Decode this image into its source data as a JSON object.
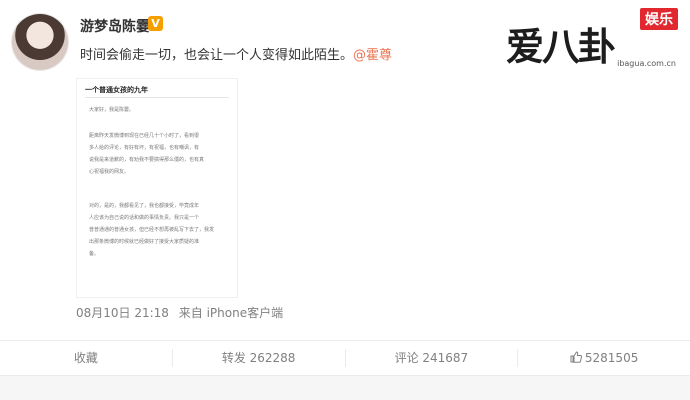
{
  "post": {
    "username": "游梦岛陈霎",
    "text": "时间会偷走一切，也会让一个人变得如此陌生。",
    "mention": "@霍尊",
    "timestamp": "08月10日 21:18",
    "source": "来自 iPhone客户端"
  },
  "article": {
    "title": "一个普通女孩的九年",
    "lines": [
      "大家好，我是陈霎。",
      "距离昨天发微博到现在已经几十个小时了，看到很",
      "多人给的评论，有好有坏，有祝福，也有嘲讽，有",
      "说我是来道歉的，有劝我不要搞得那么僵的，也有真",
      "心祝福我的网友。",
      "对的，是的，我都看见了，我也都接受，毕竟成年",
      "人应该为自己说的话和做的事情负责。我只是一个",
      "普普通通的普通女孩，但已经不想再被乱写下去了，我发",
      "出那条微博的时候就已经做好了接受大家质疑的准",
      "备。"
    ]
  },
  "actions": {
    "favorite": "收藏",
    "repost": "转发 262288",
    "comment": "评论 241687",
    "like": "5281505"
  },
  "watermark": {
    "tag": "娱乐",
    "logo": "爱八卦",
    "url": "ibagua.com.cn"
  },
  "icons": {
    "vip": "vip-badge-icon",
    "like": "thumbs-up-icon"
  }
}
